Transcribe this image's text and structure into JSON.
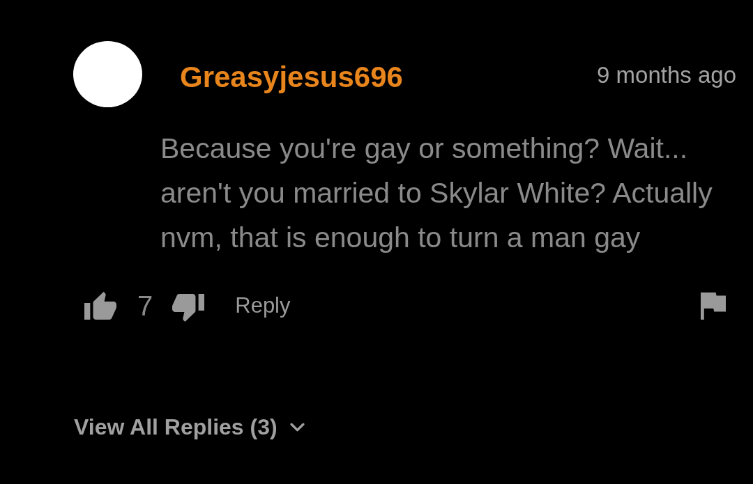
{
  "comment": {
    "author": "Greasyjesus696",
    "time": "9 months ago",
    "text": "Because you're gay or something? Wait... aren't you married to Skylar White? Actually nvm, that is enough to turn a man gay"
  },
  "actions": {
    "likes": "7",
    "reply": "Reply"
  },
  "replies": {
    "label": "View All Replies (3)",
    "expanded": false
  }
}
